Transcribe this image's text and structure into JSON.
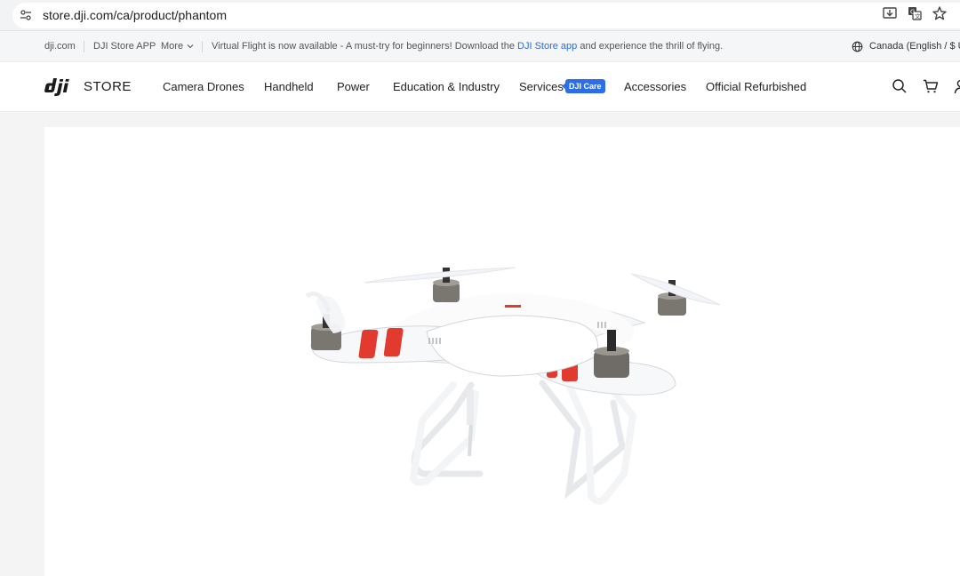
{
  "browser": {
    "url": "store.dji.com/ca/product/phantom",
    "icons": [
      "site-settings-icon",
      "install-app-icon",
      "translate-icon",
      "bookmark-star-icon"
    ]
  },
  "topstrip": {
    "dji_link": "dji.com",
    "app_link": "DJI Store APP",
    "more_label": "More",
    "announcement_prefix": "Virtual Flight is now available - A must-try for beginners! Download the",
    "announcement_link": "DJI Store app",
    "announcement_suffix": "and experience the thrill of flying.",
    "region": "Canada (English / $ US"
  },
  "nav": {
    "brand": "STORE",
    "items": [
      "Camera Drones",
      "Handheld",
      "Power",
      "Education & Industry",
      "Services",
      "Accessories",
      "Official Refurbished"
    ],
    "services_badge": "DJI Care",
    "icons": [
      "search-icon",
      "cart-icon",
      "user-icon"
    ]
  },
  "product": {
    "image": "phantom-drone-image"
  },
  "colors": {
    "accent": "#2d6ee6",
    "link": "#2b6bd9",
    "drone_red": "#e23a2e"
  }
}
